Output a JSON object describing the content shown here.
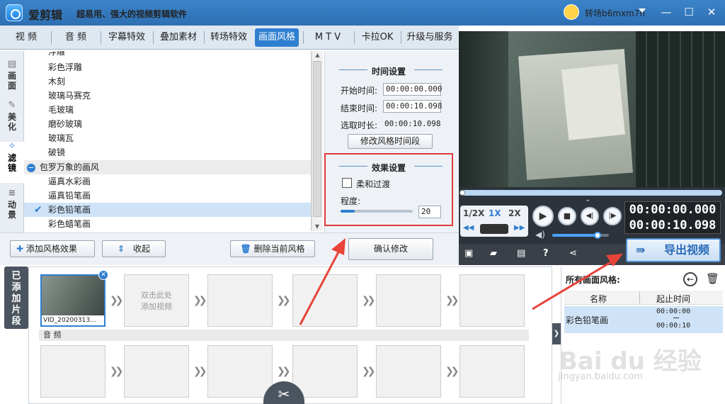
{
  "app": {
    "title": "爱剪辑",
    "slogan": "超易用、强大的视频剪辑软件",
    "username": "转场b6mxm7n"
  },
  "tabs": [
    "视 频",
    "音 频",
    "字幕特效",
    "叠加素材",
    "转场特效",
    "画面风格",
    "M T V",
    "卡拉OK",
    "升级与服务"
  ],
  "active_tab": "画面风格",
  "side_tabs": [
    "画面",
    "美化",
    "滤镜",
    "动景"
  ],
  "active_side_tab": "滤镜",
  "style_list": {
    "partial_top": "浮雕",
    "items_before": [
      "彩色浮雕",
      "木刻",
      "玻璃马赛克",
      "毛玻璃",
      "磨砂玻璃",
      "玻璃瓦",
      "破镜"
    ],
    "group": "包罗万象的画风",
    "group_items": [
      "逼真水彩画",
      "逼真铅笔画",
      "彩色铅笔画",
      "彩色蜡笔画"
    ],
    "selected": "彩色铅笔画"
  },
  "time_settings": {
    "title": "时间设置",
    "start_label": "开始时间:",
    "start_value": "00:00:00.000",
    "end_label": "结束时间:",
    "end_value": "00:00:10.098",
    "duration_label": "选取时长:",
    "duration_value": "00:00:10.098",
    "modify_button": "修改风格时间段"
  },
  "effect_settings": {
    "title": "效果设置",
    "smooth_label": "柔和过渡",
    "smooth_checked": false,
    "degree_label": "程度:",
    "degree_value": "20",
    "degree_level": 0.2
  },
  "bottom_buttons": {
    "add": "添加风格效果",
    "collapse": "收起",
    "delete": "删除当前风格",
    "confirm": "确认修改"
  },
  "player": {
    "speeds": [
      "1/2X",
      "1X",
      "2X"
    ],
    "active_speed": "1X",
    "time_current": "00:00:00.000",
    "time_total": "00:00:10.098",
    "volume_level": 0.8
  },
  "export_label": "导出视频",
  "timeline": {
    "added_label": "已添加片段",
    "clip_name": "VID_20200313...",
    "placeholder": "双击此处\n添加视频",
    "audio_label": "音 频"
  },
  "right_panel": {
    "title": "所有画面风格:",
    "col_name": "名称",
    "col_time": "起止时间",
    "row_name": "彩色铅笔画",
    "row_start": "00:00:00",
    "row_end": "00:00:10"
  },
  "watermark": {
    "brand": "Bai du 经验",
    "url": "jingyan.baidu.com"
  },
  "colors": {
    "accent": "#2f7fd1",
    "highlight": "#e03a3a",
    "titlebar": "#3b84c9"
  }
}
